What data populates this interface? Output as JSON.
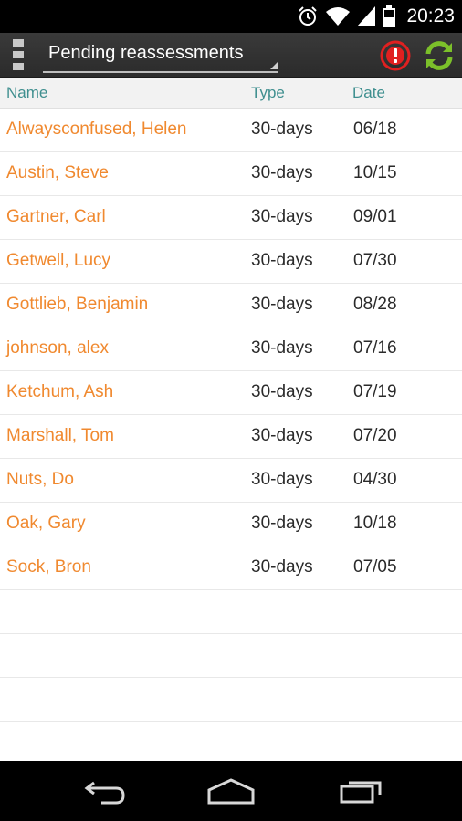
{
  "status_bar": {
    "time": "20:23",
    "icons": [
      "alarm-icon",
      "wifi-icon",
      "signal-icon",
      "battery-icon"
    ]
  },
  "action_bar": {
    "spinner_label": "Pending reassessments",
    "alert_icon_color": "#e02020",
    "refresh_icon_color": "#7cc02a"
  },
  "table": {
    "headers": {
      "name": "Name",
      "type": "Type",
      "date": "Date"
    },
    "rows": [
      {
        "name": "Alwaysconfused, Helen",
        "type": "30-days",
        "date": "06/18"
      },
      {
        "name": "Austin, Steve",
        "type": "30-days",
        "date": "10/15"
      },
      {
        "name": "Gartner, Carl",
        "type": "30-days",
        "date": "09/01"
      },
      {
        "name": "Getwell, Lucy",
        "type": "30-days",
        "date": "07/30"
      },
      {
        "name": "Gottlieb, Benjamin",
        "type": "30-days",
        "date": "08/28"
      },
      {
        "name": "johnson, alex",
        "type": "30-days",
        "date": "07/16"
      },
      {
        "name": "Ketchum, Ash",
        "type": "30-days",
        "date": "07/19"
      },
      {
        "name": "Marshall, Tom",
        "type": "30-days",
        "date": "07/20"
      },
      {
        "name": "Nuts, Do",
        "type": "30-days",
        "date": "04/30"
      },
      {
        "name": "Oak, Gary",
        "type": "30-days",
        "date": "10/18"
      },
      {
        "name": "Sock, Bron",
        "type": "30-days",
        "date": "07/05"
      }
    ]
  },
  "colors": {
    "name_text": "#f0892f",
    "header_text": "#3f8f8f"
  },
  "nav_bar": {
    "icons": [
      "back-icon",
      "home-icon",
      "recent-apps-icon"
    ]
  }
}
